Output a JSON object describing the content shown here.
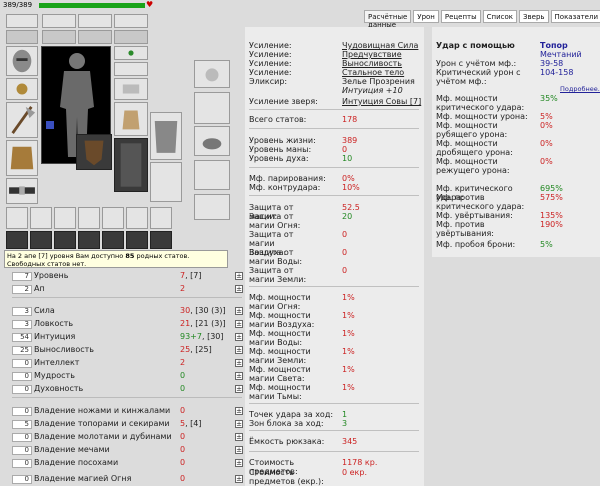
{
  "hp": {
    "text": "389/389",
    "fraction": 1.0
  },
  "tooltip": {
    "prefix": "На 2 апе [7] уровня Вам доступно ",
    "bold": "85",
    "suffix": " родных статов. Свободных статов нет."
  },
  "stats": [
    {
      "num": "7",
      "label": "Уровень",
      "val": "7",
      "val2": ", [7]",
      "vcolor": "red"
    },
    {
      "num": "2",
      "label": "Ап",
      "val": "2",
      "val2": "",
      "vcolor": "red"
    },
    {
      "num": "3",
      "label": "Сила",
      "val": "30",
      "val2": ", [30 (3)]",
      "vcolor": "red"
    },
    {
      "num": "3",
      "label": "Ловкость",
      "val": "21",
      "val2": ", [21 (3)]",
      "vcolor": "red"
    },
    {
      "num": "54",
      "label": "Интуиция",
      "val": "93+7",
      "val2": ", [30]",
      "vcolor": "green"
    },
    {
      "num": "25",
      "label": "Выносливость",
      "val": "25",
      "val2": ", [25]",
      "vcolor": "red"
    },
    {
      "num": "0",
      "label": "Интеллект",
      "val": "2",
      "val2": "",
      "vcolor": "red"
    },
    {
      "num": "0",
      "label": "Мудрость",
      "val": "0",
      "val2": "",
      "vcolor": "green"
    },
    {
      "num": "0",
      "label": "Духовность",
      "val": "0",
      "val2": "",
      "vcolor": "green"
    },
    {
      "num": "0",
      "label": "Владение ножами и кинжалами",
      "val": "0",
      "val2": "",
      "vcolor": "red"
    },
    {
      "num": "5",
      "label": "Владение топорами и секирами",
      "val": "5",
      "val2": ", [4]",
      "vcolor": "red"
    },
    {
      "num": "0",
      "label": "Владение молотами и дубинами",
      "val": "0",
      "val2": "",
      "vcolor": "red"
    },
    {
      "num": "0",
      "label": "Владение мечами",
      "val": "0",
      "val2": "",
      "vcolor": "red"
    },
    {
      "num": "0",
      "label": "Владение посохами",
      "val": "0",
      "val2": "",
      "vcolor": "red"
    },
    {
      "num": "0",
      "label": "Владение магией Огня",
      "val": "0",
      "val2": "",
      "vcolor": "red"
    }
  ],
  "tabs": [
    "Расчётные данные",
    "Урон",
    "Рецепты",
    "Список",
    "Зверь",
    "Показатели"
  ],
  "mid": {
    "buffs": [
      {
        "k": "Усиление:",
        "v": "Чудовищная Сила",
        "style": "under"
      },
      {
        "k": "Усиление:",
        "v": "Предчувствие",
        "style": "under"
      },
      {
        "k": "Усиление:",
        "v": "Выносливость",
        "style": "under"
      },
      {
        "k": "Усиление:",
        "v": "Стальное тело",
        "style": "under"
      },
      {
        "k": "Эликсир:",
        "v": "Зелье Прозрения",
        "style": ""
      }
    ],
    "elixir_extra": "Интуиция +10",
    "beast": {
      "k": "Усиление зверя:",
      "v": "Интуиция Совы [7]"
    },
    "total_stats": {
      "k": "Всего статов:",
      "v": "178"
    },
    "life": [
      {
        "k": "Уровень жизни:",
        "v": "389",
        "c": "red"
      },
      {
        "k": "Уровень маны:",
        "v": "0",
        "c": "red"
      },
      {
        "k": "Уровень духа:",
        "v": "10",
        "c": "green"
      }
    ],
    "parry": [
      {
        "k": "Мф. парирования:",
        "v": "0%",
        "c": "red"
      },
      {
        "k": "Мф. контрудара:",
        "v": "10%",
        "c": "red"
      }
    ],
    "defense": [
      {
        "k": "Защита от магии:",
        "v": "52.5",
        "c": "red"
      },
      {
        "k": "Защита от магии Огня:",
        "v": "20",
        "c": "green"
      },
      {
        "k": "Защита от магии Воздуха:",
        "v": "0",
        "c": "red"
      },
      {
        "k": "Защита от магии Воды:",
        "v": "0",
        "c": "red"
      },
      {
        "k": "Защита от магии Земли:",
        "v": "0",
        "c": "red"
      }
    ],
    "magic": [
      {
        "k": "Мф. мощности магии Огня:",
        "v": "1%",
        "c": "red"
      },
      {
        "k": "Мф. мощности магии Воздуха:",
        "v": "1%",
        "c": "red"
      },
      {
        "k": "Мф. мощности магии Воды:",
        "v": "1%",
        "c": "red"
      },
      {
        "k": "Мф. мощности магии Земли:",
        "v": "1%",
        "c": "red"
      },
      {
        "k": "Мф. мощности магии Света:",
        "v": "1%",
        "c": "red"
      },
      {
        "k": "Мф. мощности магии Тьмы:",
        "v": "1%",
        "c": "red"
      }
    ],
    "points": [
      {
        "k": "Точек удара за ход:",
        "v": "1",
        "c": "green"
      },
      {
        "k": "Зон блока за ход:",
        "v": "3",
        "c": "green"
      }
    ],
    "backpack": {
      "k": "Ёмкость рюкзака:",
      "v": "345"
    },
    "cost": [
      {
        "k": "Стоимость предметов:",
        "v": "1178 кр."
      },
      {
        "k": "Стоимость предметов (екр.):",
        "v": "0 екр."
      }
    ]
  },
  "right": {
    "title_k": "Удар с помощью",
    "title_v": "Топор",
    "title_v2": "Мечтаний",
    "dmg": [
      {
        "k": "Урон с учётом мф.:",
        "v": "39-58"
      },
      {
        "k": "Критический урон с учётом мф.:",
        "v": "104-158"
      }
    ],
    "more": "Подробнее...",
    "power": [
      {
        "k": "Мф. мощности критического удара:",
        "v": "35%",
        "c": "green"
      },
      {
        "k": "Мф. мощности урона:",
        "v": "5%",
        "c": "red"
      },
      {
        "k": "Мф. мощности рубящего урона:",
        "v": "0%",
        "c": "red"
      },
      {
        "k": "Мф. мощности дробящего урона:",
        "v": "0%",
        "c": "red"
      },
      {
        "k": "Мф. мощности режущего урона:",
        "v": "0%",
        "c": "red"
      }
    ],
    "crit": [
      {
        "k": "Мф. критического удара:",
        "v": "695%",
        "c": "green"
      },
      {
        "k": "Мф. против критического удара:",
        "v": "575%",
        "c": "red"
      },
      {
        "k": "Мф. увёртывания:",
        "v": "135%",
        "c": "red"
      },
      {
        "k": "Мф. против увёртывания:",
        "v": "190%",
        "c": "red"
      }
    ],
    "armor": {
      "k": "Мф. пробоя брони:",
      "v": "5%",
      "c": "green"
    }
  }
}
